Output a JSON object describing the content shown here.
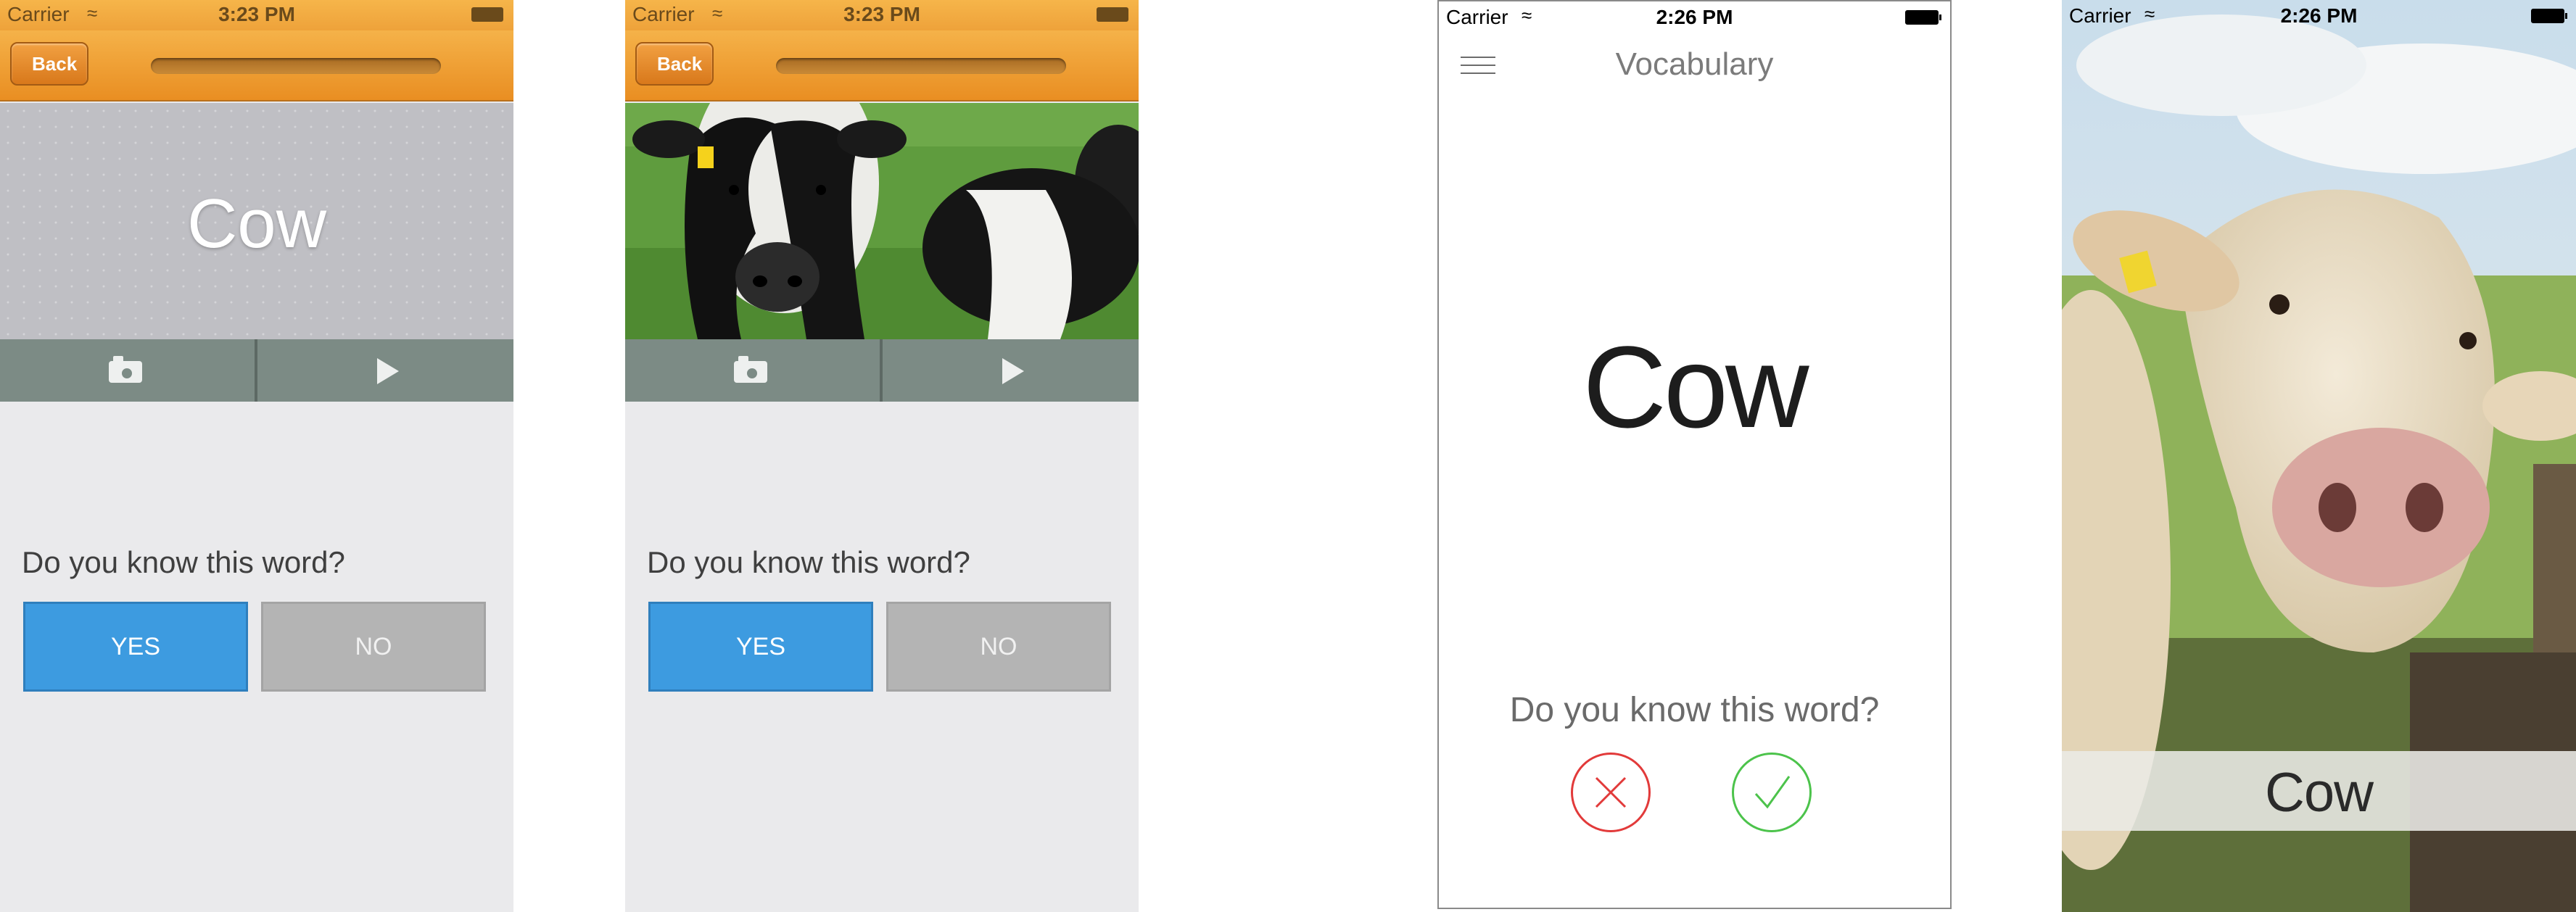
{
  "screens": [
    {
      "status": {
        "carrier": "Carrier",
        "time": "3:23 PM"
      },
      "nav": {
        "back_label": "Back"
      },
      "word": "Cow",
      "question": "Do you know this word?",
      "yes_label": "YES",
      "no_label": "NO"
    },
    {
      "status": {
        "carrier": "Carrier",
        "time": "3:23 PM"
      },
      "nav": {
        "back_label": "Back"
      },
      "question": "Do you know this word?",
      "yes_label": "YES",
      "no_label": "NO"
    },
    {
      "status": {
        "carrier": "Carrier",
        "time": "2:26 PM"
      },
      "title": "Vocabulary",
      "word": "Cow",
      "question": "Do you know this word?"
    },
    {
      "status": {
        "carrier": "Carrier",
        "time": "2:26 PM"
      },
      "word": "Cow"
    }
  ],
  "icons": [
    "wifi-icon",
    "battery-icon",
    "back-arrow-icon",
    "camera-icon",
    "play-icon",
    "menu-icon",
    "close-icon",
    "checkmark-icon"
  ],
  "colors": {
    "nav_orange": "#f0a03a",
    "yes_blue": "#3d9be0",
    "no_gray": "#b4b4b4",
    "action_bar": "#7c8b85",
    "reject_red": "#e23a3a",
    "accept_green": "#4cc34b"
  }
}
